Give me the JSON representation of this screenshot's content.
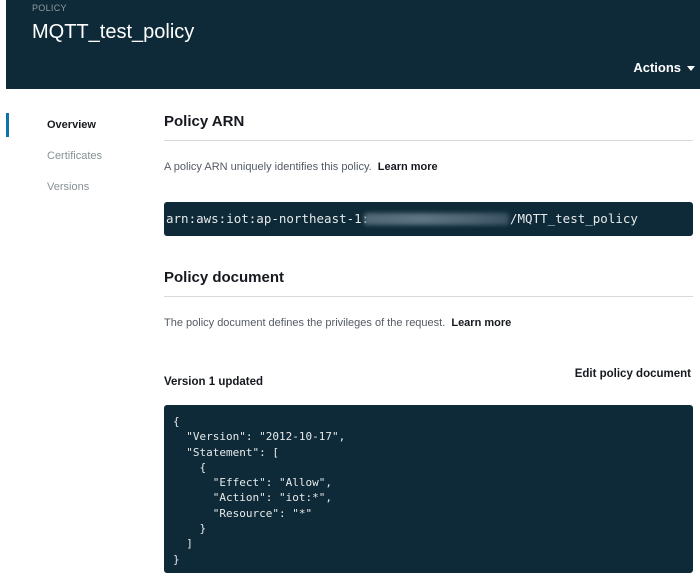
{
  "header": {
    "kicker": "POLICY",
    "title": "MQTT_test_policy",
    "actions_label": "Actions"
  },
  "sidenav": {
    "items": [
      {
        "label": "Overview",
        "active": true
      },
      {
        "label": "Certificates",
        "active": false
      },
      {
        "label": "Versions",
        "active": false
      }
    ]
  },
  "arn_section": {
    "title": "Policy ARN",
    "description": "A policy ARN uniquely identifies this policy.",
    "learn_more": "Learn more",
    "arn_prefix": "arn:aws:iot:ap-northeast-1:",
    "arn_suffix": "/MQTT_test_policy"
  },
  "document_section": {
    "title": "Policy document",
    "description": "The policy document defines the privileges of the request.",
    "learn_more": "Learn more",
    "version_label": "Version 1 updated",
    "edit_label": "Edit policy document",
    "document_text": "{\n  \"Version\": \"2012-10-17\",\n  \"Statement\": [\n    {\n      \"Effect\": \"Allow\",\n      \"Action\": \"iot:*\",\n      \"Resource\": \"*\"\n    }\n  ]\n}"
  },
  "colors": {
    "header_bg": "#0e2a38",
    "code_bg": "#0e2a38",
    "active_indicator": "#0f73aa"
  }
}
